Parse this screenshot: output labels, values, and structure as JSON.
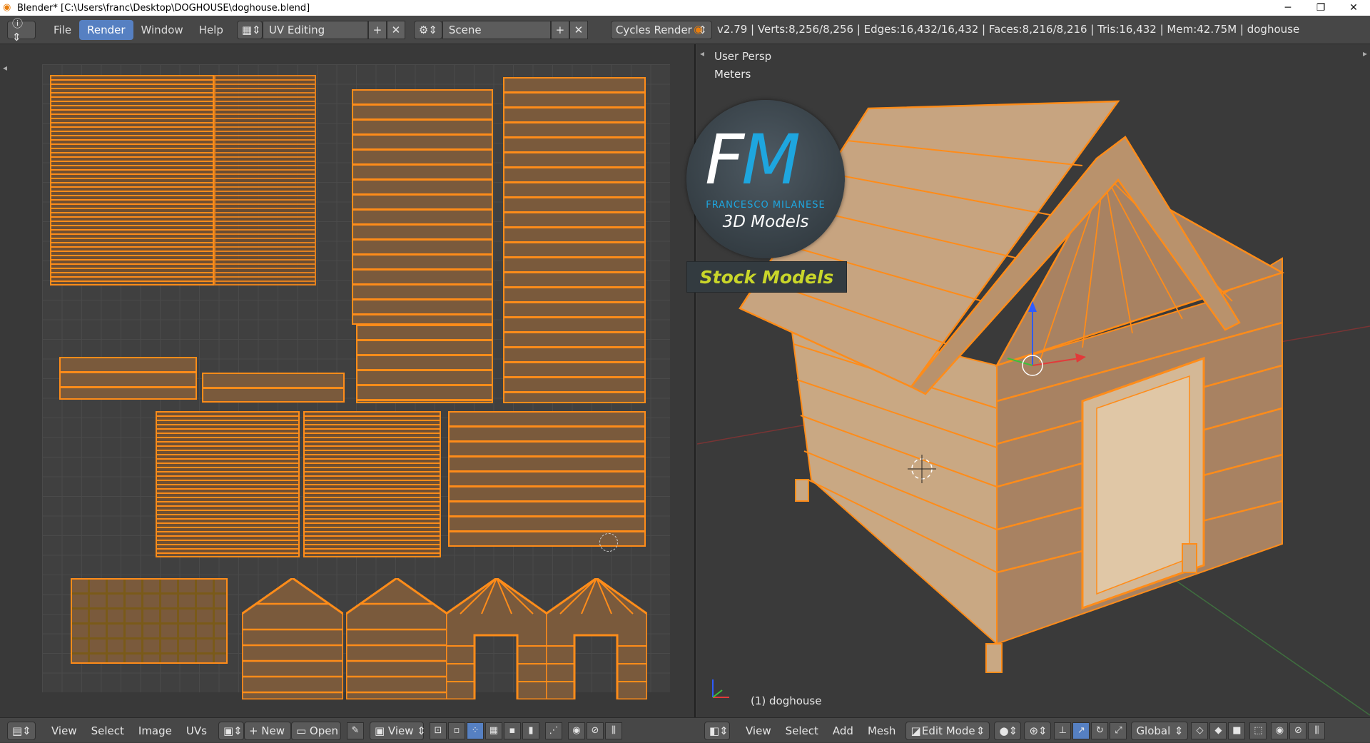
{
  "window": {
    "title": "Blender* [C:\\Users\\franc\\Desktop\\DOGHOUSE\\doghouse.blend]",
    "minimize": "─",
    "restore": "❐",
    "close": "✕"
  },
  "infobar": {
    "menus": [
      "File",
      "Render",
      "Window",
      "Help"
    ],
    "active_menu": "Render",
    "layout_name": "UV Editing",
    "scene_name": "Scene",
    "render_engine": "Cycles Render",
    "stats": "v2.79 | Verts:8,256/8,256 | Edges:16,432/16,432 | Faces:8,216/8,216 | Tris:16,432 | Mem:42.75M | doghouse"
  },
  "viewport": {
    "view_name": "User Persp",
    "units": "Meters",
    "object_label": "(1) doghouse",
    "logo": {
      "initial_f": "F",
      "initial_m": "M",
      "name": "FRANCESCO MILANESE",
      "subtitle": "3D Models",
      "banner": "Stock Models"
    }
  },
  "uv_footer": {
    "menus": [
      "View",
      "Select",
      "Image",
      "UVs"
    ],
    "new_label": "New",
    "open_label": "Open",
    "view_label": "View"
  },
  "view3d_footer": {
    "menus": [
      "View",
      "Select",
      "Add",
      "Mesh"
    ],
    "mode": "Edit Mode",
    "orientation": "Global"
  },
  "colors": {
    "accent": "#5680c2",
    "wire": "#ff8c19",
    "logo_blue": "#1ea6df",
    "banner_text": "#c9d62a"
  }
}
